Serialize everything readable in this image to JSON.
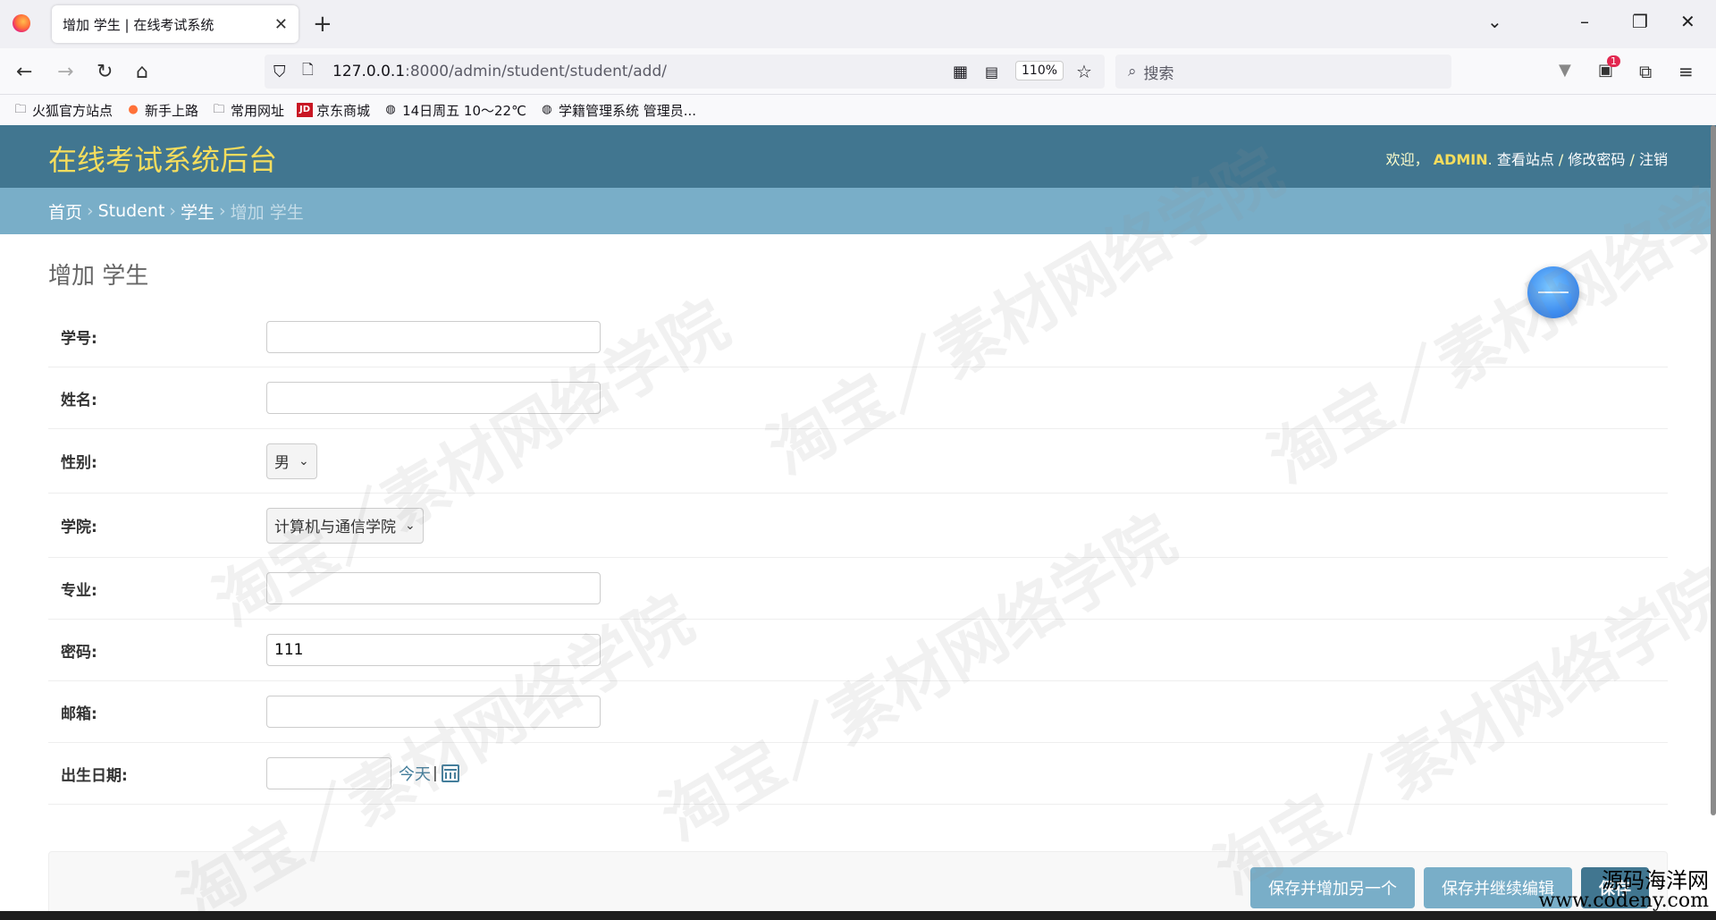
{
  "browser": {
    "tab_title": "增加 学生 | 在线考试系统",
    "url_host": "127.0.0.1",
    "url_path": ":8000/admin/student/student/add/",
    "zoom": "110%",
    "search_placeholder": "搜索",
    "extension_badge": "1",
    "bookmarks": [
      {
        "label": "火狐官方站点",
        "icon": "folder-icon"
      },
      {
        "label": "新手上路",
        "icon": "firefox-icon"
      },
      {
        "label": "常用网址",
        "icon": "folder-icon"
      },
      {
        "label": "京东商城",
        "icon": "jd-icon"
      },
      {
        "label": "14日周五  10～22℃",
        "icon": "globe-icon"
      },
      {
        "label": "学籍管理系统 管理员...",
        "icon": "globe-icon"
      }
    ]
  },
  "header": {
    "site_name": "在线考试系统后台",
    "welcome": "欢迎，",
    "username": "ADMIN",
    "view_site": "查看站点",
    "change_password": "修改密码",
    "logout": "注销",
    "sep": " / "
  },
  "breadcrumbs": {
    "home": "首页",
    "app": "Student",
    "model": "学生",
    "current": "增加 学生",
    "sep": "›"
  },
  "page": {
    "title": "增加 学生"
  },
  "form": {
    "student_id_label": "学号:",
    "student_id_value": "",
    "name_label": "姓名:",
    "name_value": "",
    "gender_label": "性别:",
    "gender_value": "男",
    "college_label": "学院:",
    "college_value": "计算机与通信学院",
    "major_label": "专业:",
    "major_value": "",
    "password_label": "密码:",
    "password_value": "111",
    "email_label": "邮箱:",
    "email_value": "",
    "birthday_label": "出生日期:",
    "birthday_value": "",
    "today_link": "今天",
    "today_sep": "|"
  },
  "submit": {
    "save_add_another": "保存并增加另一个",
    "save_continue": "保存并继续编辑",
    "save": "保存"
  },
  "watermark": {
    "text": "淘宝／素材网络学院",
    "corner_line1": "源码海洋网",
    "corner_line2": "www.codeny.com"
  },
  "colors": {
    "header_bg": "#417690",
    "breadcrumb_bg": "#79aec8",
    "site_title": "#f5dd5d",
    "link": "#447e9b"
  }
}
